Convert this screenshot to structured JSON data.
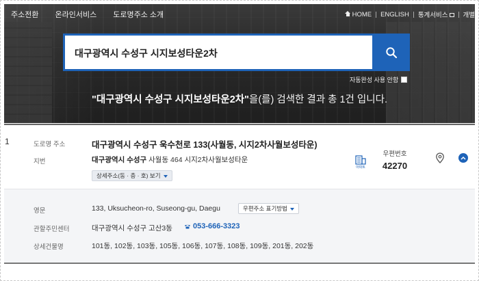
{
  "topnav": {
    "left_items": [
      "주소전환",
      "온라인서비스",
      "도로명주소 소개"
    ],
    "home": "HOME",
    "english": "ENGLISH",
    "stats": "통계서비스",
    "dev": "개별"
  },
  "search": {
    "value": "대구광역시 수성구 시지보성타운2차",
    "autocomplete_label": "자동완성 사용 안함"
  },
  "result_message": {
    "query_quoted": "\"대구광역시 수성구 시지보성타운2차\"",
    "suffix": "을(를) 검색한 결과 총 1건 입니다."
  },
  "result": {
    "index": "1",
    "road_label": "도로명 주소",
    "road_address": "대구광역시 수성구 욱수천로 133(사월동, 시지2차사월보성타운)",
    "jibun_label": "지번",
    "jibun_bold": "대구광역시 수성구",
    "jibun_rest": "사월동 464 시지2차사월보성타운",
    "detail_button": "상세주소(동 · 층 · 호) 보기",
    "building_type": "아파트",
    "zip_label": "우편번호",
    "zip": "42270"
  },
  "detail": {
    "english_label": "영문",
    "english_value": "133, Uksucheon-ro, Suseong-gu, Daegu",
    "postal_method_button": "우편주소 표기방법",
    "center_label": "관할주민센터",
    "center_value": "대구광역시 수성구 고산3동",
    "phone": "053-666-3323",
    "buildings_label": "상세건물명",
    "buildings_value": "101동, 102동, 103동, 105동, 106동, 107동, 108동, 109동, 201동, 202동"
  },
  "colors": {
    "accent": "#1e63b8",
    "hero_bg": "#2a2a2a"
  }
}
